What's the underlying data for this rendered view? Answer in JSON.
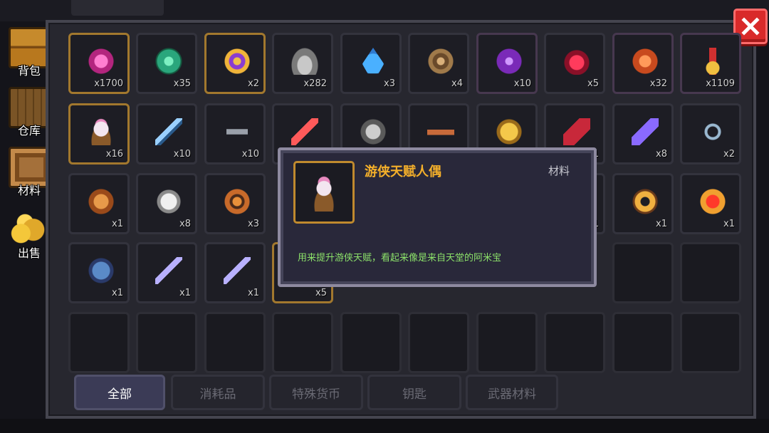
{
  "side_menu": [
    {
      "label": "背包",
      "icon": "chest-icon"
    },
    {
      "label": "仓库",
      "icon": "crate-icon"
    },
    {
      "label": "材料",
      "icon": "scroll-icon"
    },
    {
      "label": "出售",
      "icon": "gold-pile-icon"
    }
  ],
  "grid": {
    "row1": [
      {
        "icon": "pink-gem-icon",
        "count": "x1700"
      },
      {
        "icon": "green-coin-icon",
        "count": "x35"
      },
      {
        "icon": "purple-coin-icon",
        "count": "x2"
      },
      {
        "icon": "ore-icon",
        "count": "x282"
      },
      {
        "icon": "blue-key-drop-icon",
        "count": "x3"
      },
      {
        "icon": "brown-coin-icon",
        "count": "x4"
      },
      {
        "icon": "purple-orb-icon",
        "count": "x10"
      },
      {
        "icon": "red-claw-icon",
        "count": "x5"
      },
      {
        "icon": "orange-block-icon",
        "count": "x32"
      },
      {
        "icon": "medal-icon",
        "count": "x1109"
      }
    ],
    "row2": [
      {
        "icon": "doll-icon",
        "count": "x16"
      },
      {
        "icon": "blue-weapon-icon",
        "count": "x10"
      },
      {
        "icon": "gray-weapon-icon",
        "count": "x10"
      },
      {
        "icon": "red-weapon-icon",
        "count": ""
      },
      {
        "icon": "stone-bar-icon",
        "count": ""
      },
      {
        "icon": "rifle-icon",
        "count": ""
      },
      {
        "icon": "gold-wing-icon",
        "count": ""
      },
      {
        "icon": "red-fan-icon",
        "count": "1"
      },
      {
        "icon": "violet-shot-icon",
        "count": "x8"
      },
      {
        "icon": "chain-icon",
        "count": "x2"
      }
    ],
    "row3": [
      {
        "icon": "tan-box-icon",
        "count": "x1"
      },
      {
        "icon": "white-pill-icon",
        "count": "x8"
      },
      {
        "icon": "amber-frame-icon",
        "count": "x3"
      },
      {
        "icon": "",
        "count": ""
      },
      {
        "icon": "",
        "count": ""
      },
      {
        "icon": "",
        "count": ""
      },
      {
        "icon": "",
        "count": ""
      },
      {
        "icon": "",
        "count": "1"
      },
      {
        "icon": "gold-ring-icon",
        "count": "x1"
      },
      {
        "icon": "red-pot-icon",
        "count": "x1"
      }
    ],
    "row4": [
      {
        "icon": "blue-jar-icon",
        "count": "x1"
      },
      {
        "icon": "purple-spear-icon",
        "count": "x1"
      },
      {
        "icon": "purple-sword-icon",
        "count": "x1"
      },
      {
        "icon": "",
        "count": "x5"
      }
    ]
  },
  "tabs": [
    "全部",
    "消耗品",
    "特殊货币",
    "钥匙",
    "武器材料"
  ],
  "tooltip": {
    "name": "游侠天赋人偶",
    "type": "材料",
    "description": "用来提升游侠天赋，看起来像是来自天堂的阿米宝"
  }
}
